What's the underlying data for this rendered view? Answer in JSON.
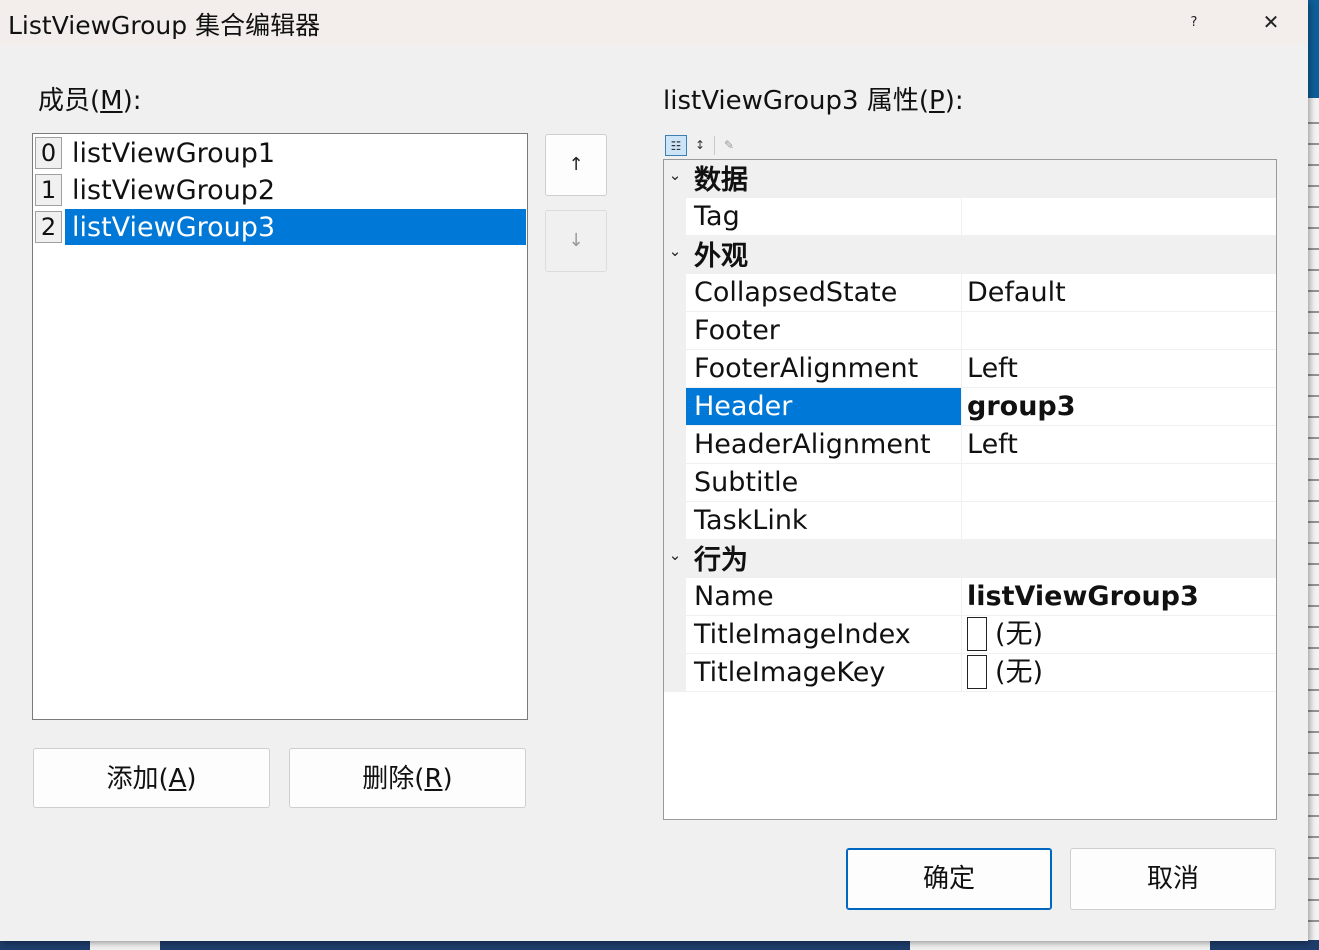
{
  "window": {
    "title": "ListViewGroup 集合编辑器",
    "help_glyph": "?",
    "close_glyph": "✕"
  },
  "members": {
    "label_prefix": "成员(",
    "label_key": "M",
    "label_suffix": "):",
    "items": [
      {
        "index": "0",
        "name": "listViewGroup1",
        "selected": false
      },
      {
        "index": "1",
        "name": "listViewGroup2",
        "selected": false
      },
      {
        "index": "2",
        "name": "listViewGroup3",
        "selected": true
      }
    ],
    "move_up_glyph": "↑",
    "move_down_glyph": "↓",
    "add_prefix": "添加(",
    "add_key": "A",
    "add_suffix": ")",
    "remove_prefix": "删除(",
    "remove_key": "R",
    "remove_suffix": ")"
  },
  "properties": {
    "label_prefix": "listViewGroup3 属性(",
    "label_key": "P",
    "label_suffix": "):",
    "toolbar": {
      "categorized_icon": "categorized-view-icon",
      "alphabetical_icon": "alphabetical-sort-icon",
      "property_pages_icon": "wrench-icon",
      "categorized_glyph": "☷",
      "alphabetical_glyph": "↕",
      "wrench_glyph": "✎"
    },
    "chevron_glyph": "⌄",
    "categories": [
      {
        "name": "数据",
        "rows": [
          {
            "name": "Tag",
            "value": ""
          }
        ]
      },
      {
        "name": "外观",
        "rows": [
          {
            "name": "CollapsedState",
            "value": "Default"
          },
          {
            "name": "Footer",
            "value": ""
          },
          {
            "name": "FooterAlignment",
            "value": "Left"
          },
          {
            "name": "Header",
            "value": "group3",
            "bold": true,
            "selected": true
          },
          {
            "name": "HeaderAlignment",
            "value": "Left"
          },
          {
            "name": "Subtitle",
            "value": ""
          },
          {
            "name": "TaskLink",
            "value": ""
          }
        ]
      },
      {
        "name": "行为",
        "rows": [
          {
            "name": "Name",
            "value": "listViewGroup3",
            "bold": true
          },
          {
            "name": "TitleImageIndex",
            "value": "(无)",
            "swatch": true
          },
          {
            "name": "TitleImageKey",
            "value": "(无)",
            "swatch": true
          }
        ]
      }
    ]
  },
  "footer": {
    "ok_label": "确定",
    "cancel_label": "取消"
  },
  "colors": {
    "selection": "#0078d7",
    "dialog_bg": "#f0f0f0",
    "titlebar_bg": "#f3eeec"
  }
}
